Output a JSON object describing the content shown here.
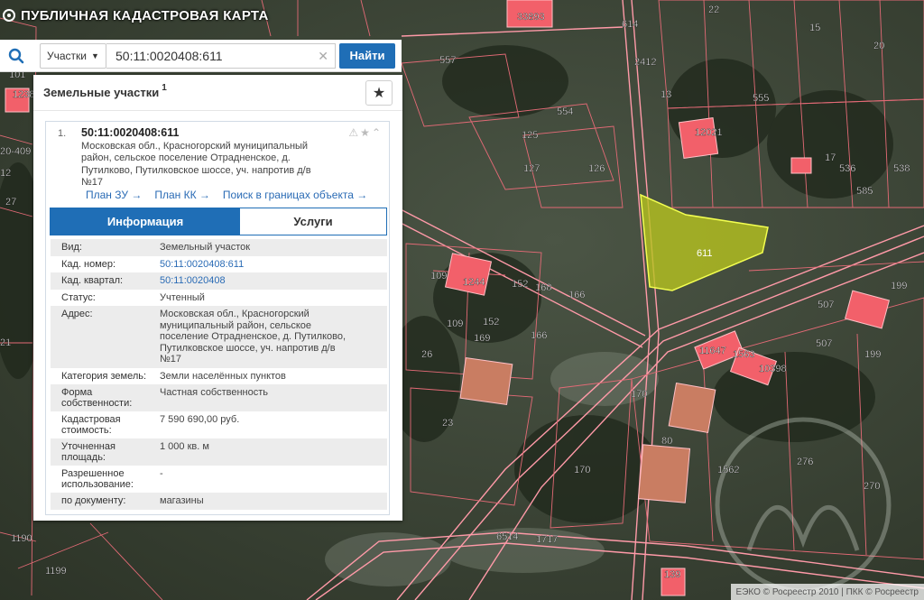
{
  "app": {
    "title": "ПУБЛИЧНАЯ КАДАСТРОВАЯ КАРТА"
  },
  "search": {
    "type_label": "Участки",
    "query": "50:11:0020408:611",
    "button": "Найти"
  },
  "panel": {
    "title": "Земельные участки",
    "count_sup": "1",
    "result": {
      "index": "1.",
      "cad_number": "50:11:0020408:611",
      "address_lines": [
        "Московская обл., Красногорский муниципальный",
        "район, сельское поселение Отрадненское, д.",
        "Путилково, Путилковское шоссе, уч. напротив д/в",
        "№17"
      ],
      "links": [
        "План ЗУ →",
        "План КК →",
        "Поиск в границах объекта →"
      ],
      "tabs": [
        "Информация",
        "Услуги"
      ],
      "info": [
        {
          "k": [
            "Вид:"
          ],
          "v": [
            "Земельный участок"
          ],
          "link": false
        },
        {
          "k": [
            "Кад. номер:"
          ],
          "v": [
            "50:11:0020408:611"
          ],
          "link": true
        },
        {
          "k": [
            "Кад. квартал:"
          ],
          "v": [
            "50:11:0020408"
          ],
          "link": true
        },
        {
          "k": [
            "Статус:"
          ],
          "v": [
            "Учтенный"
          ],
          "link": false
        },
        {
          "k": [
            "Адрес:"
          ],
          "v": [
            "Московская обл., Красногорский",
            "муниципальный район, сельское",
            "поселение Отрадненское, д. Путилково,",
            "Путилковское шоссе, уч. напротив д/в",
            "№17"
          ],
          "link": false
        },
        {
          "k": [
            "Категория земель:"
          ],
          "v": [
            "Земли населённых пунктов"
          ],
          "link": false
        },
        {
          "k": [
            "Форма",
            "собственности:"
          ],
          "v": [
            "Частная собственность"
          ],
          "link": false
        },
        {
          "k": [
            "Кадастровая",
            "стоимость:"
          ],
          "v": [
            "7 590 690,00 руб."
          ],
          "link": false
        },
        {
          "k": [
            "Уточненная",
            "площадь:"
          ],
          "v": [
            "1 000 кв. м"
          ],
          "link": false
        },
        {
          "k": [
            "Разрешенное",
            "использование:"
          ],
          "v": [
            "-"
          ],
          "link": false
        },
        {
          "k": [
            "по документу:"
          ],
          "v": [
            "магазины"
          ],
          "link": false
        }
      ]
    }
  },
  "map": {
    "selected_parcel": "611",
    "parcel_labels": [
      "33893",
      "22",
      "15",
      "20",
      "557",
      "2412",
      "614",
      "13",
      "555",
      "554",
      "12021",
      "17",
      "536",
      "585",
      "538",
      "125",
      "127",
      "126",
      "109",
      "1244",
      "152",
      "168",
      "166",
      "109",
      "152",
      "169",
      "166",
      "26",
      "23",
      "11647",
      "1563",
      "10398",
      "199",
      "507",
      "507",
      "199",
      "170",
      "80",
      "170",
      "1562",
      "276",
      "270",
      "6514",
      "1717",
      "139",
      "1199",
      "1190",
      "20-409",
      "27",
      "101",
      "1238",
      "21",
      "12"
    ],
    "attribution": "ЕЭКО © Росреестр 2010 | ПКК © Росреестр"
  },
  "colors": {
    "accent": "#1f6eb6",
    "parcel_fill": "#b7c31f",
    "boundary": "#ff9aa8",
    "building": "#f2606a"
  }
}
